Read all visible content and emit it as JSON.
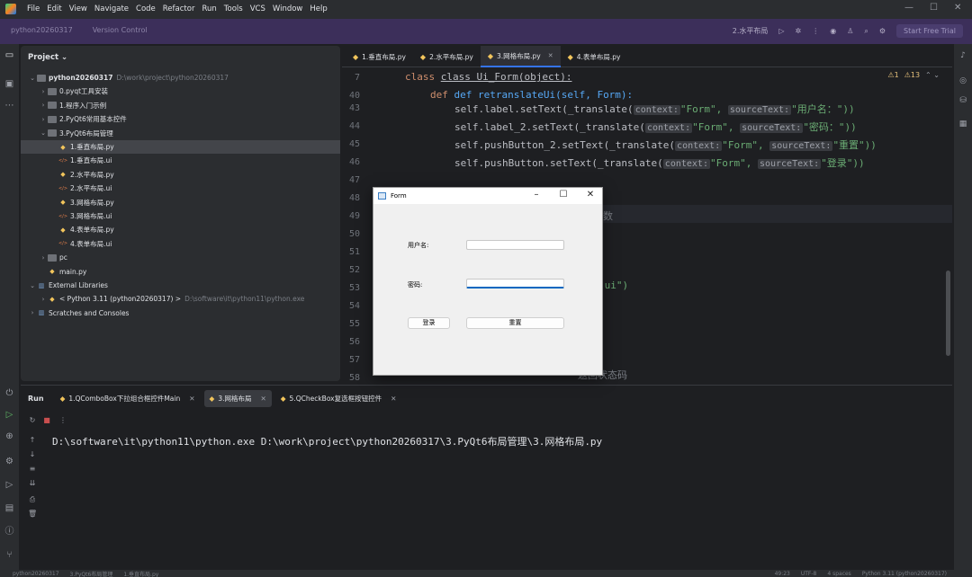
{
  "menubar": {
    "items": [
      "File",
      "Edit",
      "View",
      "Navigate",
      "Code",
      "Refactor",
      "Run",
      "Tools",
      "VCS",
      "Window",
      "Help"
    ]
  },
  "toolbar": {
    "project": "python20260317",
    "vcs": "Version Control",
    "run_config": "2.水平布局",
    "trial": "Start Free Trial"
  },
  "project": {
    "header": "Project",
    "rows": [
      {
        "label": "python20260317",
        "extra": "D:\\work\\project\\python20260317",
        "indent": 0,
        "arrow": "⌄",
        "icon": "folder",
        "bold": true
      },
      {
        "label": "0.pyqt工具安装",
        "extra": "",
        "indent": 1,
        "arrow": "›",
        "icon": "folder"
      },
      {
        "label": "1.程序入门示例",
        "extra": "",
        "indent": 1,
        "arrow": "›",
        "icon": "folder"
      },
      {
        "label": "2.PyQt6常用基本控件",
        "extra": "",
        "indent": 1,
        "arrow": "›",
        "icon": "folder"
      },
      {
        "label": "3.PyQt6布局管理",
        "extra": "",
        "indent": 1,
        "arrow": "⌄",
        "icon": "folder"
      },
      {
        "label": "1.垂直布局.py",
        "extra": "",
        "indent": 2,
        "arrow": "",
        "icon": "py",
        "sel": true
      },
      {
        "label": "1.垂直布局.ui",
        "extra": "",
        "indent": 2,
        "arrow": "",
        "icon": "ui"
      },
      {
        "label": "2.水平布局.py",
        "extra": "",
        "indent": 2,
        "arrow": "",
        "icon": "py"
      },
      {
        "label": "2.水平布局.ui",
        "extra": "",
        "indent": 2,
        "arrow": "",
        "icon": "ui"
      },
      {
        "label": "3.网格布局.py",
        "extra": "",
        "indent": 2,
        "arrow": "",
        "icon": "py"
      },
      {
        "label": "3.网格布局.ui",
        "extra": "",
        "indent": 2,
        "arrow": "",
        "icon": "ui"
      },
      {
        "label": "4.表单布局.py",
        "extra": "",
        "indent": 2,
        "arrow": "",
        "icon": "py"
      },
      {
        "label": "4.表单布局.ui",
        "extra": "",
        "indent": 2,
        "arrow": "",
        "icon": "ui"
      },
      {
        "label": "pc",
        "extra": "",
        "indent": 1,
        "arrow": "›",
        "icon": "folder"
      },
      {
        "label": "main.py",
        "extra": "",
        "indent": 1,
        "arrow": "",
        "icon": "py"
      },
      {
        "label": "External Libraries",
        "extra": "",
        "indent": 0,
        "arrow": "⌄",
        "icon": "lib"
      },
      {
        "label": "< Python 3.11 (python20260317) >",
        "extra": "D:\\software\\it\\python11\\python.exe",
        "indent": 1,
        "arrow": "›",
        "icon": "py"
      },
      {
        "label": "Scratches and Consoles",
        "extra": "",
        "indent": 0,
        "arrow": "›",
        "icon": "lib"
      }
    ]
  },
  "editor": {
    "tabs": [
      {
        "label": "1.垂直布局.py",
        "active": false
      },
      {
        "label": "2.水平布局.py",
        "active": false
      },
      {
        "label": "3.网格布局.py",
        "active": true
      },
      {
        "label": "4.表单布局.py",
        "active": false
      }
    ],
    "warnings": {
      "warn": "1",
      "weak": "13"
    },
    "line_numbers": [
      "7",
      "40",
      "43",
      "44",
      "45",
      "46",
      "47",
      "48",
      "49",
      "50",
      "51",
      "52",
      "53",
      "54",
      "55",
      "56",
      "57",
      "58"
    ],
    "sticky_class": "class Ui_Form(object):",
    "sticky_def": "def retranslateUi(self, Form):",
    "line43": {
      "code": "self.label.setText(_translate(",
      "hint1": "context:",
      "s1": "\"Form\",",
      "hint2": "sourceText:",
      "s2": "\"用户名：\"))"
    },
    "line44": {
      "code": "self.label_2.setText(_translate(",
      "hint1": "context:",
      "s1": "\"Form\",",
      "hint2": "sourceText:",
      "s2": "\"密码：\"))"
    },
    "line45": {
      "code": "self.pushButton_2.setText(_translate(",
      "hint1": "context:",
      "s1": "\"Form\",",
      "hint2": "sourceText:",
      "s2": "\"重置\"))"
    },
    "line46": {
      "code": "self.pushButton.setText(_translate(",
      "hint1": "context:",
      "s1": "\"Form\",",
      "hint2": "sourceText:",
      "s2": "\"登录\"))"
    },
    "line49_tail": "数",
    "line53_tail": ".ui\")",
    "line58_tail": "返回状态码"
  },
  "dialog": {
    "title": "Form",
    "user_label": "用户名:",
    "pass_label": "密码:",
    "login_button": "登录",
    "reset_button": "重置"
  },
  "run": {
    "label": "Run",
    "tabs": [
      {
        "label": "1.QComboBox下拉组合框控件Main",
        "active": false
      },
      {
        "label": "3.网格布局",
        "active": true
      },
      {
        "label": "5.QCheckBox复选框按钮控件",
        "active": false
      }
    ],
    "command": "D:\\software\\it\\python11\\python.exe D:\\work\\project\\python20260317\\3.PyQt6布局管理\\3.网格布局.py"
  },
  "statusbar": {
    "crumbs": [
      "python20260317",
      "3.PyQt6布局管理",
      "1.垂直布局.py"
    ],
    "right": [
      "49:23",
      "UTF-8",
      "4 spaces",
      "Python 3.11 (python20260317)"
    ]
  }
}
